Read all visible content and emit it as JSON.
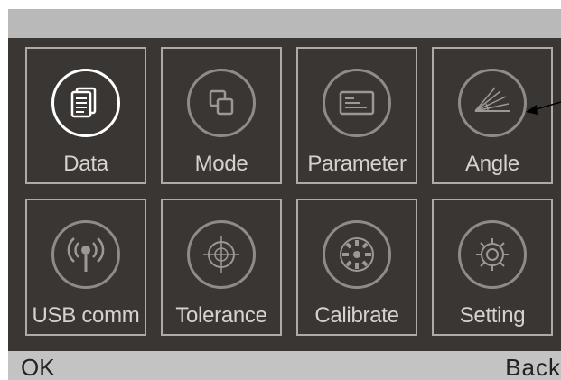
{
  "menu": {
    "items": [
      {
        "label": "Data",
        "icon": "data-icon",
        "selected": true
      },
      {
        "label": "Mode",
        "icon": "mode-icon",
        "selected": false
      },
      {
        "label": "Parameter",
        "icon": "parameter-icon",
        "selected": false
      },
      {
        "label": "Angle",
        "icon": "angle-icon",
        "selected": false
      },
      {
        "label": "USB comm",
        "icon": "usb-comm-icon",
        "selected": false
      },
      {
        "label": "Tolerance",
        "icon": "tolerance-icon",
        "selected": false
      },
      {
        "label": "Calibrate",
        "icon": "calibrate-icon",
        "selected": false
      },
      {
        "label": "Setting",
        "icon": "setting-icon",
        "selected": false
      }
    ]
  },
  "footer": {
    "ok_label": "OK",
    "back_label": "Back"
  },
  "colors": {
    "background": "#3a3634",
    "tile_border": "#aeaba7",
    "selected_ring": "#ffffff",
    "bar": "#c3c3c3"
  }
}
